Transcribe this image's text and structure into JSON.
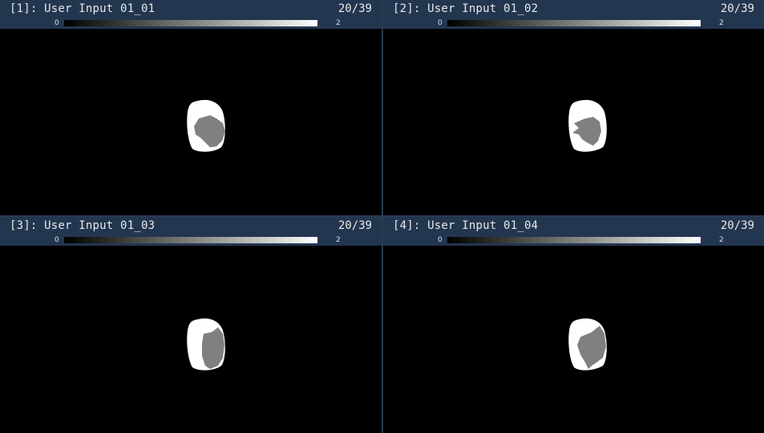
{
  "colorbar": {
    "min_label": "0",
    "max_label": "2",
    "colors": [
      "#000000",
      "#ffffff"
    ]
  },
  "panes": [
    {
      "title": "[1]: User Input 01_01",
      "slice": "20/39"
    },
    {
      "title": "[2]: User Input 01_02",
      "slice": "20/39"
    },
    {
      "title": "[3]: User Input 01_03",
      "slice": "20/39"
    },
    {
      "title": "[4]: User Input 01_04",
      "slice": "20/39"
    }
  ],
  "colors": {
    "header_bg": "#233650",
    "divider": "#2a3b52",
    "label_value_1": "#ffffff",
    "label_value_2": "#808080"
  }
}
